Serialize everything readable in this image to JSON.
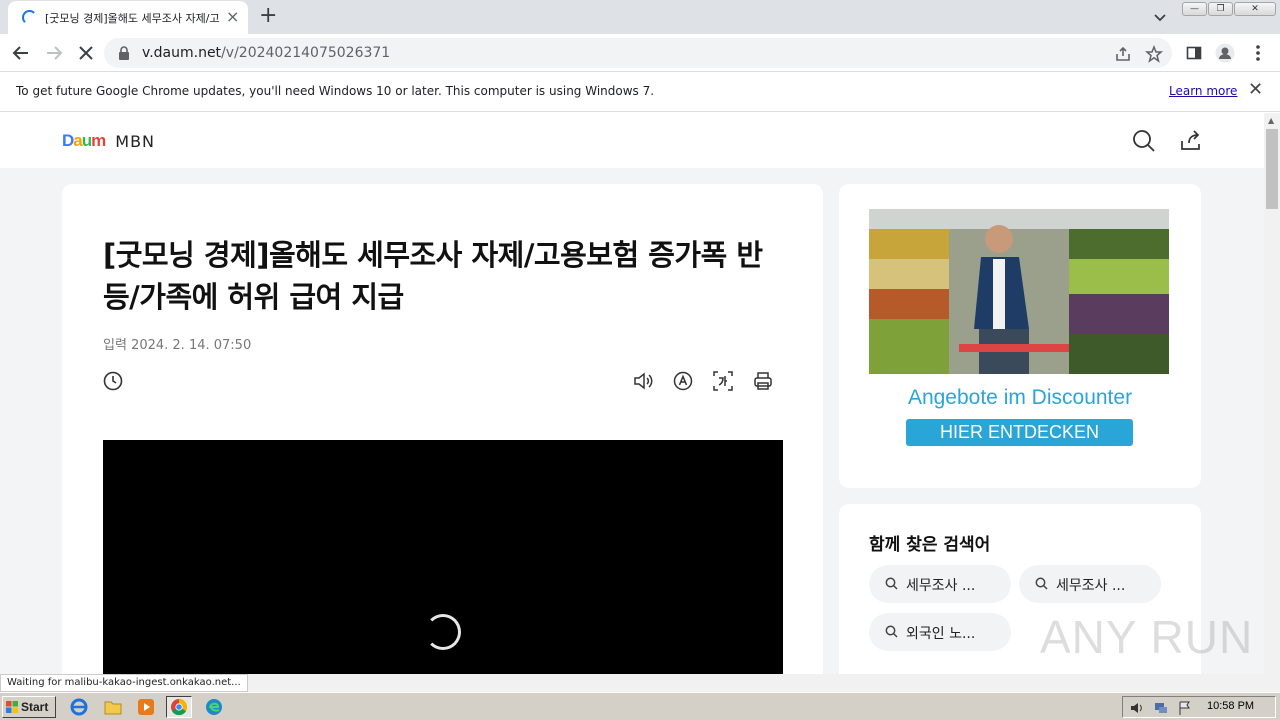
{
  "browser": {
    "tab_title": "[굿모닝 경제]올해도 세무조사 자제/고",
    "url_host": "v.daum.net",
    "url_path": "/v/20240214075026371"
  },
  "infobar": {
    "message": "To get future Google Chrome updates, you'll need Windows 10 or later. This computer is using Windows 7.",
    "link": "Learn more"
  },
  "site": {
    "logo_text": "Daum",
    "channel": "MBN"
  },
  "article": {
    "headline": "[굿모닝 경제]올해도 세무조사 자제/고용보험 증가폭 반등/가족에 허위 급여 지급",
    "date_label": "입력",
    "date_value": "2024. 2. 14. 07:50"
  },
  "ad": {
    "tagline": "Angebote im Discounter",
    "cta": "HIER ENTDECKEN"
  },
  "related": {
    "title": "함께 찾은 검색어",
    "chips": [
      "세무조사 ...",
      "세무조사 ...",
      "외국인 노..."
    ]
  },
  "watermark": "ANY RUN",
  "status_bar": "Waiting for malibu-kakao-ingest.onkakao.net...",
  "taskbar": {
    "start": "Start",
    "clock": "10:58 PM"
  },
  "colors": {
    "accent": "#1a73e8",
    "ad_blue": "#2aa5d8",
    "page_bg": "#f3f4f6"
  }
}
